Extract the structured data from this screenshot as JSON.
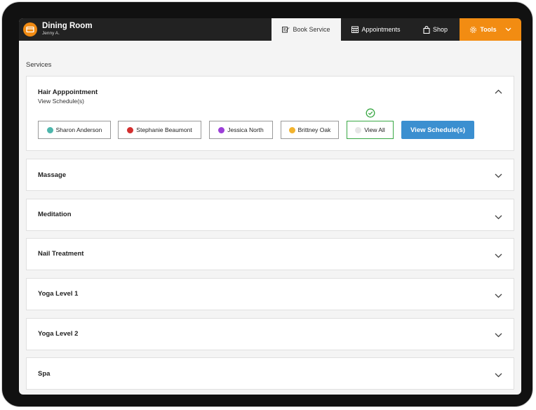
{
  "header": {
    "title": "Dining Room",
    "subtitle": "Jenny A.",
    "logo_icon": "credit-card-icon"
  },
  "tabs": [
    {
      "label": "Book Service",
      "icon": "edit-icon",
      "active": true
    },
    {
      "label": "Appointments",
      "icon": "calendar-icon",
      "active": false
    },
    {
      "label": "Shop",
      "icon": "shopping-bag-icon",
      "active": false
    },
    {
      "label": "Tools",
      "icon": "gear-icon",
      "active": false
    }
  ],
  "section_label": "Services",
  "expanded_service": {
    "title": "Hair Apppointment",
    "subtitle": "View Schedule(s)",
    "staff": [
      {
        "name": "Sharon Anderson",
        "color": "#4db6ac"
      },
      {
        "name": "Stephanie Beaumont",
        "color": "#d32f2f"
      },
      {
        "name": "Jessica North",
        "color": "#9c3fd8"
      },
      {
        "name": "Brittney Oak",
        "color": "#f2b32e"
      },
      {
        "name": "View All",
        "color": "#e6e6e6",
        "selected": true
      }
    ],
    "action_label": "View Schedule(s)"
  },
  "services": [
    {
      "title": "Massage"
    },
    {
      "title": "Meditation"
    },
    {
      "title": "Nail Treatment"
    },
    {
      "title": "Yoga Level 1"
    },
    {
      "title": "Yoga Level 2"
    },
    {
      "title": "Spa"
    }
  ],
  "colors": {
    "accent": "#f28c12",
    "primary_button": "#3b8fd0",
    "selected_border": "#3aa845",
    "topbar": "#222222"
  }
}
